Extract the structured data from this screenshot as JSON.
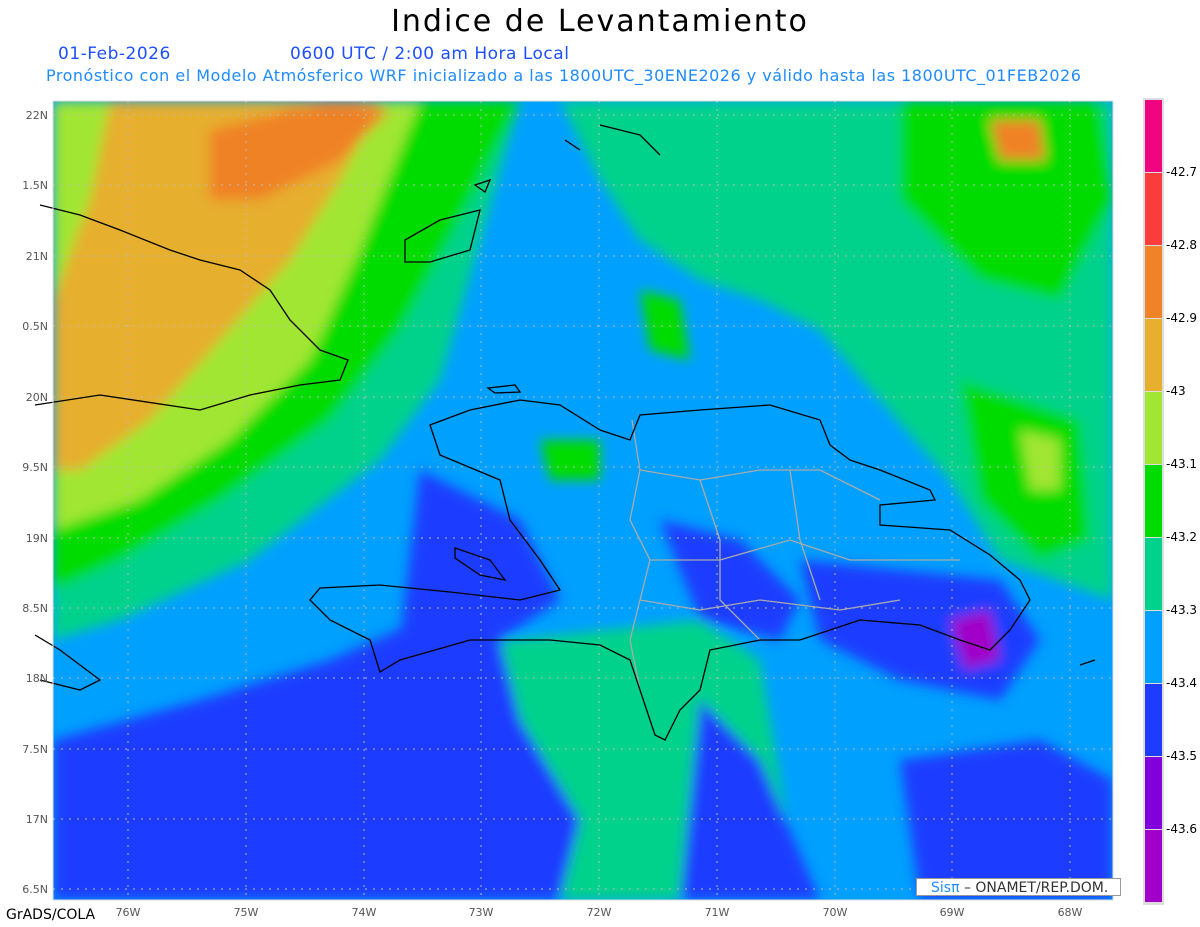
{
  "title": "Indice de Levantamiento",
  "date_line": "01-Feb-2026",
  "time_line": "0600 UTC / 2:00 am Hora Local",
  "description": "Pronóstico con el Modelo Atmósferico WRF inicializado a las 1800UTC_30ENE2026 y válido hasta las  1800UTC_01FEB2026",
  "map": {
    "lon_range": [
      -76.64,
      -67.63
    ],
    "lat_range": [
      16.42,
      22.1
    ],
    "lat_labels": [
      "22N",
      "1.5N",
      "21N",
      "0.5N",
      "20N",
      "9.5N",
      "19N",
      "8.5N",
      "18N",
      "7.5N",
      "17N",
      "6.5N"
    ],
    "lon_labels": [
      "76W",
      "75W",
      "74W",
      "73W",
      "72W",
      "71W",
      "70W",
      "69W",
      "68W"
    ]
  },
  "colorbar": {
    "labels": [
      "-42.7",
      "-42.8",
      "-42.9",
      "-43",
      "-43.1",
      "-43.2",
      "-43.3",
      "-43.4",
      "-43.5",
      "-43.6"
    ],
    "colors": [
      "#f0047f",
      "#fa3c3c",
      "#f08228",
      "#e6af2d",
      "#a0e632",
      "#00dc00",
      "#00d28c",
      "#00a0ff",
      "#1e3cff",
      "#8200dc",
      "#a000c8"
    ]
  },
  "credit": {
    "logo": "Sisπ",
    "text": " – ONAMET/REP.DOM."
  },
  "footer": "GrADS/COLA"
}
